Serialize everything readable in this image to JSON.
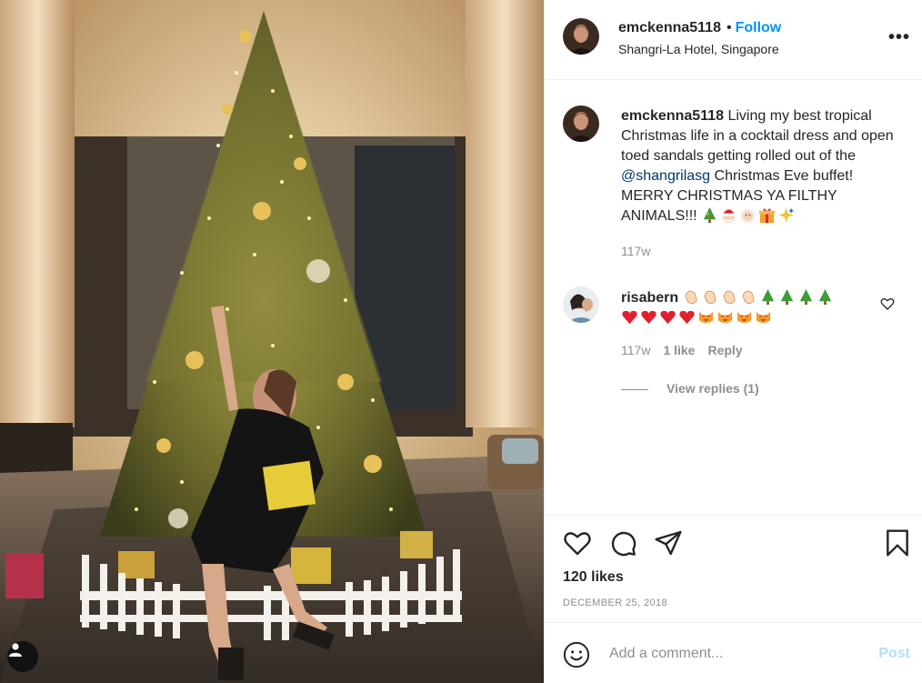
{
  "post": {
    "username": "emckenna5118",
    "follow_label": "Follow",
    "dot": "•",
    "location": "Shangri-La Hotel, Singapore",
    "more_label": "•••"
  },
  "caption": {
    "username": "emckenna5118",
    "text_before": "Living my best tropical Christmas life in a cocktail dress and open toed sandals getting rolled out of the",
    "mention": "@shangrilasg",
    "text_after": "Christmas Eve buffet! MERRY CHRISTMAS YA FILTHY ANIMALS!!!",
    "emojis": [
      "christmas-tree-emoji",
      "santa-emoji",
      "mrs-claus-emoji",
      "gift-emoji",
      "sparkles-emoji"
    ],
    "age": "117w"
  },
  "comment": {
    "username": "risabern",
    "emojis_row1": [
      "clap-emoji",
      "clap-emoji",
      "clap-emoji",
      "clap-emoji",
      "christmas-tree-emoji",
      "christmas-tree-emoji",
      "christmas-tree-emoji",
      "christmas-tree-emoji"
    ],
    "emojis_row2": [
      "red-heart-emoji",
      "red-heart-emoji",
      "red-heart-emoji",
      "red-heart-emoji",
      "heart-eyes-cat-emoji",
      "heart-eyes-cat-emoji",
      "heart-eyes-cat-emoji",
      "heart-eyes-cat-emoji"
    ],
    "age": "117w",
    "likes": "1 like",
    "reply_label": "Reply",
    "view_replies": "View replies (1)"
  },
  "actions": {
    "likes": "120 likes",
    "date": "DECEMBER 25, 2018",
    "icons": [
      "heart-icon",
      "comment-icon",
      "share-icon",
      "bookmark-icon"
    ]
  },
  "add_comment": {
    "placeholder": "Add a comment...",
    "post_label": "Post"
  },
  "colors": {
    "accent": "#0095f6",
    "mention": "#00376b",
    "muted": "#8e8e8e",
    "post_disabled": "#b2dffc"
  }
}
